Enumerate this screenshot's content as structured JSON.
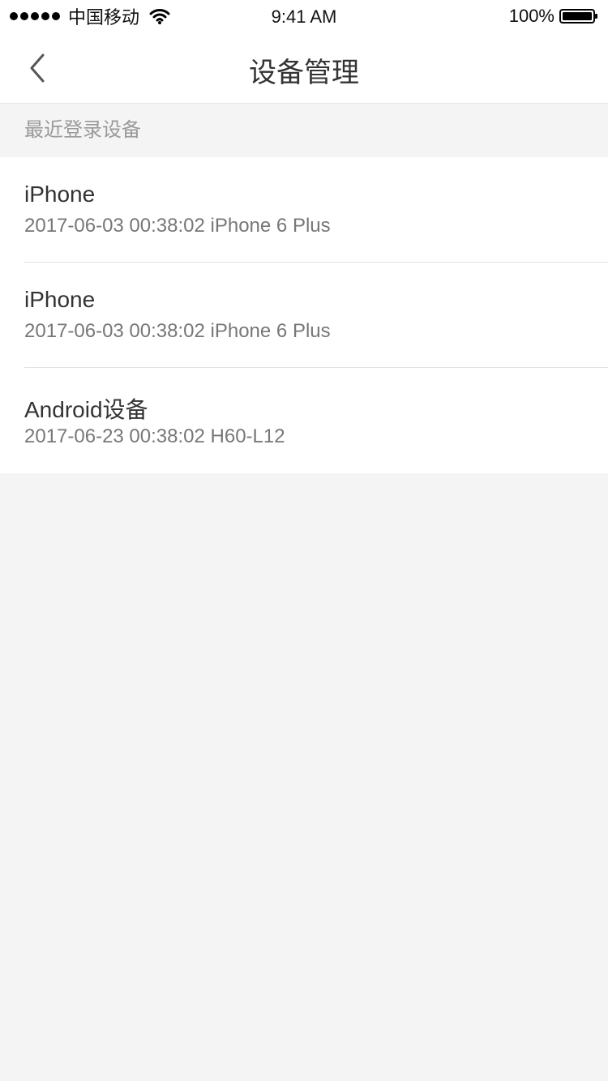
{
  "status_bar": {
    "carrier": "中国移动",
    "time": "9:41 AM",
    "battery_percent": "100%",
    "signal_icon": "signal-dots-icon",
    "wifi_icon": "wifi-icon",
    "battery_icon": "battery-icon"
  },
  "nav": {
    "back_icon": "chevron-left-icon",
    "title": "设备管理"
  },
  "section": {
    "title": "最近登录设备"
  },
  "devices": [
    {
      "name": "iPhone",
      "detail": "2017-06-03 00:38:02 iPhone 6 Plus"
    },
    {
      "name": "iPhone",
      "detail": "2017-06-03 00:38:02 iPhone 6 Plus"
    },
    {
      "name": "Android设备",
      "detail": "2017-06-23 00:38:02 H60-L12"
    }
  ],
  "colors": {
    "page_background": "#f4f4f4",
    "surface": "#ffffff",
    "primary_text": "#333333",
    "secondary_text": "#777777",
    "section_text": "#999999",
    "divider": "#e2e2e2"
  }
}
